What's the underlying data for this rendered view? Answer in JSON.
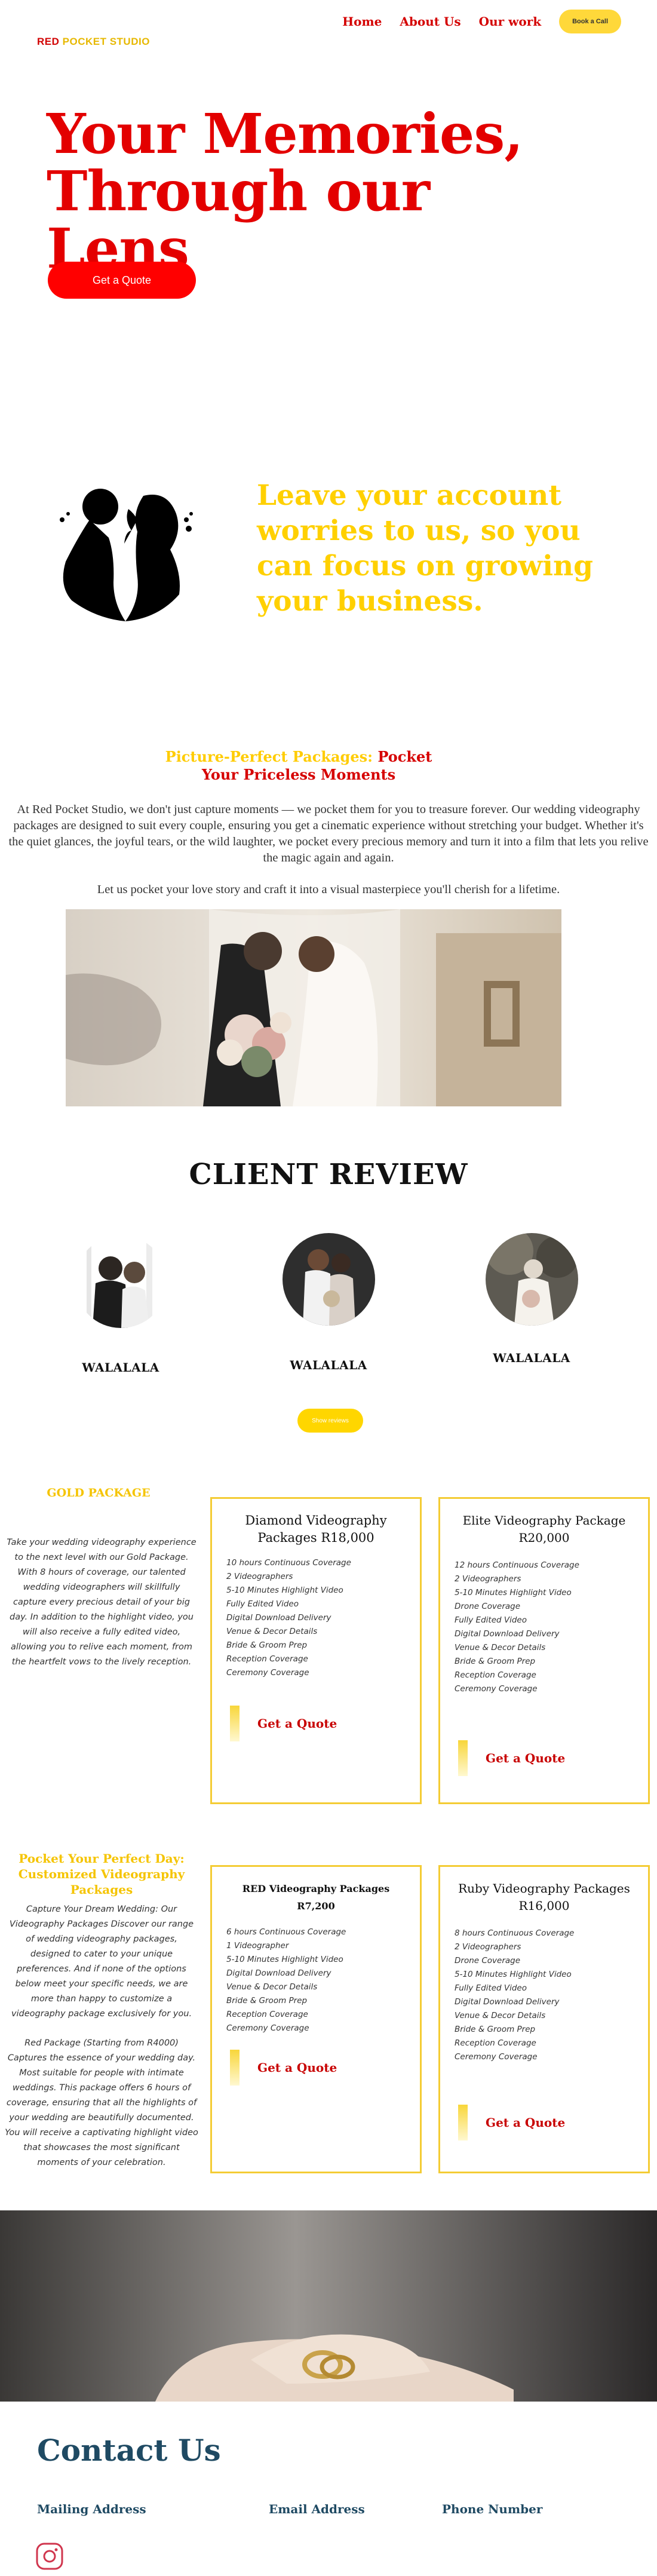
{
  "header": {
    "logo_red": "RED",
    "logo_gold": "POCKET STUDIO",
    "nav": [
      "Home",
      "About Us",
      "Our work"
    ],
    "book_label": "Book a Call"
  },
  "hero": {
    "title_line1": "Your Memories,",
    "title_line2": "Through our Lens",
    "cta": "Get a Quote"
  },
  "tagline": "Leave your account worries to us, so you can focus on growing your business.",
  "packages_intro": {
    "title_gold": "Picture-Perfect Packages:",
    "title_red": "Pocket Your Priceless Moments",
    "body": "At Red Pocket Studio, we don't just capture moments — we pocket them for you to treasure forever. Our wedding videography packages are designed to suit every couple, ensuring you get a cinematic experience without stretching your budget. Whether it's the quiet glances, the joyful tears, or the wild laughter, we pocket every precious memory and turn it into a film that lets you relive the magic again and again.",
    "body2": "Let us pocket your love story and craft it into a visual masterpiece you'll cherish for a lifetime."
  },
  "reviews": {
    "title": "CLIENT REVIEW",
    "reviewers": [
      "WALALALA",
      "WALALALA",
      "WALALALA"
    ],
    "show_button": "Show reviews"
  },
  "gold_package": {
    "heading": "GOLD PACKAGE",
    "description": "Take your wedding videography experience to the next level with our Gold Package. With 8 hours of coverage, our talented wedding videographers will skillfully capture every precious detail of your big day. In addition to the highlight video, you will also receive a fully edited video, allowing you to relive each moment, from the heartfelt vows to the lively reception."
  },
  "cards": {
    "diamond": {
      "title": "Diamond Videography Packages R18,000",
      "items": [
        "10 hours Continuous Coverage",
        "2 Videographers",
        "5-10 Minutes Highlight Video",
        "Fully Edited Video",
        "Digital Download Delivery",
        "Venue & Decor Details",
        "Bride & Groom Prep",
        "Reception Coverage",
        "Ceremony Coverage"
      ],
      "cta": "Get a Quote"
    },
    "elite": {
      "title": "Elite Videography Package R20,000",
      "items": [
        "12 hours Continuous Coverage",
        "2 Videographers",
        "5-10 Minutes Highlight Video",
        "Drone Coverage",
        "Fully Edited Video",
        "Digital Download Delivery",
        "Venue & Decor Details",
        "Bride & Groom Prep",
        "Reception Coverage",
        "Ceremony Coverage"
      ],
      "cta": "Get a Quote"
    },
    "red": {
      "title": "RED Videography Packages R7,200",
      "items": [
        "6 hours Continuous Coverage",
        "1 Videographer",
        "5-10 Minutes Highlight Video",
        "Digital Download Delivery",
        "Venue & Decor Details",
        "Bride & Groom Prep",
        "Reception Coverage",
        "Ceremony Coverage"
      ],
      "cta": "Get a Quote"
    },
    "ruby": {
      "title": "Ruby Videography Packages R16,000",
      "items": [
        "8 hours Continuous Coverage",
        "2 Videographers",
        "Drone Coverage",
        "5-10 Minutes Highlight Video",
        "Fully Edited Video",
        "Digital Download Delivery",
        "Venue & Decor Details",
        "Bride & Groom Prep",
        "Reception Coverage",
        "Ceremony Coverage"
      ],
      "cta": "Get a Quote"
    }
  },
  "custom": {
    "heading": "Pocket Your Perfect Day: Customized Videography Packages",
    "description": "Capture Your Dream Wedding: Our Videography Packages Discover our range of wedding videography packages, designed to cater to your unique preferences. And if none of the options below meet your specific needs, we are more than happy to customize a videography package exclusively for you.",
    "red_package": "Red Package (Starting from R4000) Captures the essence of your wedding day. Most suitable for people with intimate weddings. This package offers 6 hours of coverage, ensuring that all the highlights of your wedding are beautifully documented. You will receive a captivating highlight video that showcases the most significant moments of your celebration."
  },
  "contact": {
    "title": "Contact Us",
    "labels": [
      "Mailing Address",
      "Email Address",
      "Phone Number"
    ]
  },
  "colors": {
    "brand_red": "#e30000",
    "brand_gold": "#ffd000",
    "contact_blue": "#1f4a63"
  }
}
